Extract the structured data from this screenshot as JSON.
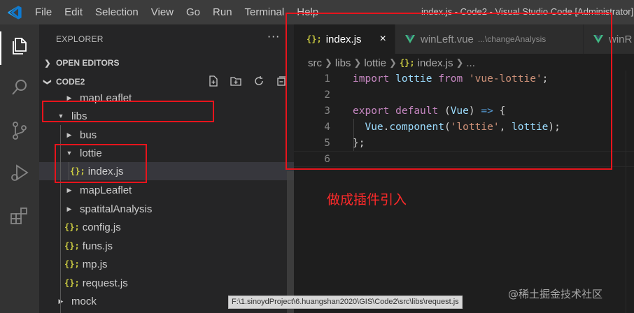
{
  "titlebar": {
    "menu": [
      "File",
      "Edit",
      "Selection",
      "View",
      "Go",
      "Run",
      "Terminal",
      "Help"
    ],
    "title": "index.js - Code2 - Visual Studio Code [Administrator]"
  },
  "activitybar": {
    "icons": [
      "explorer-icon",
      "search-icon",
      "source-control-icon",
      "run-debug-icon",
      "extensions-icon"
    ]
  },
  "sidebar": {
    "title": "EXPLORER",
    "more": "···",
    "open_editors": "OPEN EDITORS",
    "project": "CODE2",
    "tree": [
      {
        "label": "mapLeaflet",
        "kind": "folder-collapsed",
        "depth": 2
      },
      {
        "label": "libs",
        "kind": "folder-expanded",
        "depth": 1
      },
      {
        "label": "bus",
        "kind": "folder-collapsed",
        "depth": 2
      },
      {
        "label": "lottie",
        "kind": "folder-expanded",
        "depth": 2
      },
      {
        "label": "index.js",
        "kind": "js-file",
        "depth": 3,
        "selected": true
      },
      {
        "label": "mapLeaflet",
        "kind": "folder-collapsed",
        "depth": 2
      },
      {
        "label": "spatitalAnalysis",
        "kind": "folder-collapsed",
        "depth": 2
      },
      {
        "label": "config.js",
        "kind": "js-file",
        "depth": 2
      },
      {
        "label": "funs.js",
        "kind": "js-file",
        "depth": 2
      },
      {
        "label": "mp.js",
        "kind": "js-file",
        "depth": 2
      },
      {
        "label": "request.js",
        "kind": "js-file",
        "depth": 2
      },
      {
        "label": "mock",
        "kind": "folder-collapsed",
        "depth": 1
      }
    ]
  },
  "js_icon": "{};",
  "editor": {
    "tabs": [
      {
        "label": "index.js",
        "icon": "js-file-icon",
        "active": true,
        "close": "×"
      },
      {
        "label": "winLeft.vue",
        "icon": "vue-icon",
        "desc": "...\\changeAnalysis"
      },
      {
        "label": "winR",
        "icon": "vue-icon"
      }
    ],
    "breadcrumb": [
      "src",
      "libs",
      "lottie",
      "index.js",
      "..."
    ],
    "lines": [
      {
        "num": "1",
        "tokens": [
          [
            "import",
            "kw2"
          ],
          [
            " ",
            "pl"
          ],
          [
            "lottie",
            "id"
          ],
          [
            " ",
            "pl"
          ],
          [
            "from",
            "kw2"
          ],
          [
            " ",
            "pl"
          ],
          [
            "'vue-lottie'",
            "str"
          ],
          [
            ";",
            "pl"
          ]
        ]
      },
      {
        "num": "2",
        "tokens": []
      },
      {
        "num": "3",
        "tokens": [
          [
            "export",
            "kw2"
          ],
          [
            " ",
            "pl"
          ],
          [
            "default",
            "kw2"
          ],
          [
            " (",
            "pl"
          ],
          [
            "Vue",
            "id"
          ],
          [
            ") ",
            "pl"
          ],
          [
            "=>",
            "kw"
          ],
          [
            " {",
            "pl"
          ]
        ]
      },
      {
        "num": "4",
        "tokens": [
          [
            "  ",
            "pl"
          ],
          [
            "Vue",
            "id"
          ],
          [
            ".",
            "pl"
          ],
          [
            "component",
            "id"
          ],
          [
            "(",
            "pl"
          ],
          [
            "'lottie'",
            "str"
          ],
          [
            ", ",
            "pl"
          ],
          [
            "lottie",
            "id"
          ],
          [
            ");",
            "pl"
          ]
        ]
      },
      {
        "num": "5",
        "tokens": [
          [
            "};",
            "pl"
          ]
        ]
      },
      {
        "num": "6",
        "tokens": []
      }
    ]
  },
  "annotation": "做成插件引入",
  "tooltip": "F:\\1.sinoydProject\\6.huangshan2020\\GIS\\Code2\\src\\libs\\request.js",
  "watermark": "@稀土掘金技术社区",
  "colors": {
    "highlight": "#e8141c",
    "js_icon": "#cbcb41",
    "vue_icon": "#41b883",
    "keyword": "#c586c0",
    "string": "#ce9178",
    "identifier": "#9cdcfe"
  }
}
